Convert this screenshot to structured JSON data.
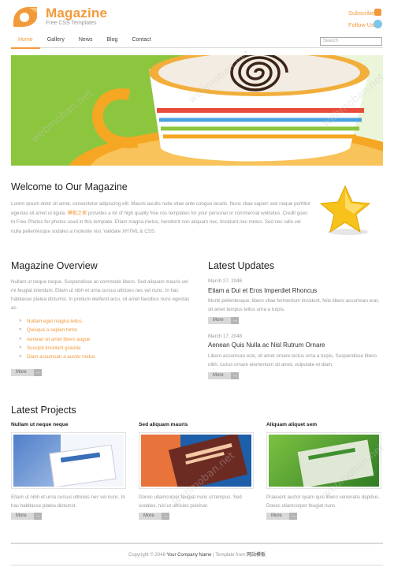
{
  "header": {
    "title": "Magazine",
    "tagline": "Free CSS Templates",
    "subscribe": "Subscribe",
    "follow_us": "Follow Us",
    "brand_color": "#f29a3a"
  },
  "nav": {
    "items": [
      "Home",
      "Gallery",
      "News",
      "Blog",
      "Contact"
    ],
    "active": "Home",
    "search_placeholder": "Search"
  },
  "welcome": {
    "title": "Welcome to Our Magazine",
    "text_before": "Lorem ipsum dolor sit amet, consectetur adipiscing elit. Mauris iaculis nulla vitae ante congue iaculis. Nunc vitae sapien sed neque porttitor egestas sit amet ut ligula.",
    "highlight": "模板之家",
    "text_after": "provides a lot of high quality free css templates for your personal or commercial websites. Credit goes to Free Photos for photos used in this template. Etiam magna metus, hendrerit non aliquam nec, tincidunt nec metus. Sed nec odio vel nulla pellentesque sodales a molestie nisi. Validate XHTML & CSS."
  },
  "overview": {
    "title": "Magazine Overview",
    "text": "Nullam ut neque neque. Suspendisse ac commodo libero. Sed aliquam mauris vel mi feugiat interdum. Etiam ut nibh et urna cursus ultricies nec vel nunc. In hac habitasse platea dictumst. In pretium eleifend arcu, sit amet faucibus nunc egestas ac.",
    "list": [
      "Nullam eget magna tellus",
      "Quisque a sapien tortor",
      "Aenean sit amet libero augue",
      "Suscipit tincidunt gravida",
      "Diam accumsan a auctor metus"
    ],
    "more": "More"
  },
  "updates": {
    "title": "Latest Updates",
    "items": [
      {
        "date": "March 27, 2048",
        "title": "Etiam a Dui et Eros Imperdiet Rhoncus",
        "text": "Morbi pellentesque, libero vitae fermentum tincidunt, felis libero accumsan erat, sit amet tempus tellus urna a turpis.",
        "more": "More"
      },
      {
        "date": "March 17, 2048",
        "title": "Aenean Quis Nulla ac Nisl Rutrum Ornare",
        "text": "Libero accumsan erat, sit amet ornare lectus urna a turpis. Suspendisse libero nibh, luctus ornare elementum sit amet, vulputate et diam.",
        "more": "More"
      }
    ]
  },
  "projects": {
    "title": "Latest Projects",
    "items": [
      {
        "title": "Nullam ut neque neque",
        "text": "Etiam ut nibh et urna cursus ultricies nec vel nunc. In hac habitasse platea dictumst.",
        "more": "More"
      },
      {
        "title": "Sed aliquam mauris",
        "text": "Donec ullamcorper feugiat nunc ut tempus. Sed sodales, nisl ut ultricies pulvinar.",
        "more": "More"
      },
      {
        "title": "Aliquam aliquet sem",
        "text": "Praesent auctor quam quis libero venenatis dapibus. Donec ullamcorper feugiat nunc.",
        "more": "More"
      }
    ]
  },
  "footer": {
    "copyright": "Copyright © 2048",
    "company": "Your Company Name",
    "sep": "| Template from",
    "site": "网站模板"
  },
  "watermark": "webmoban.net"
}
